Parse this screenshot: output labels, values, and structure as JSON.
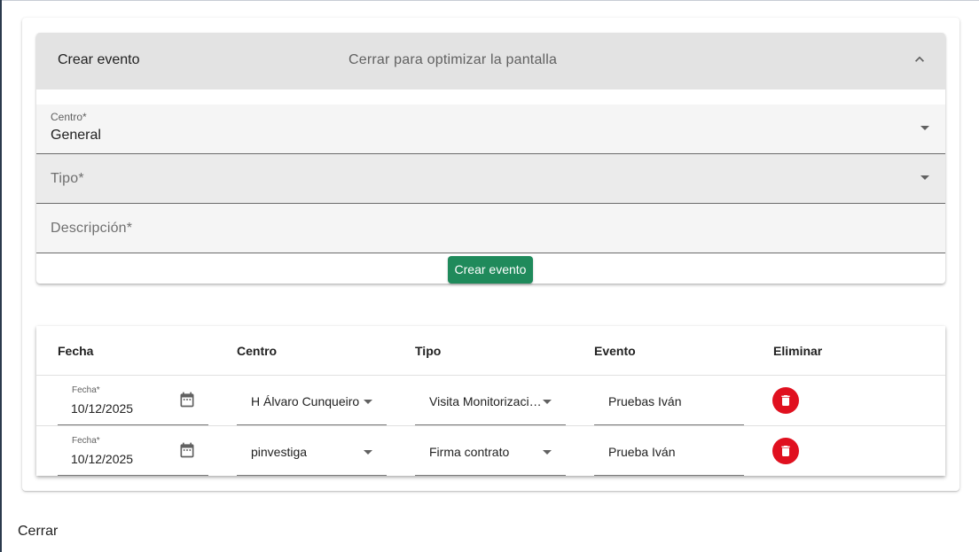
{
  "panel": {
    "title": "Crear evento",
    "description": "Cerrar para optimizar la pantalla",
    "expand_icon": "chevron-up-icon"
  },
  "form": {
    "centro": {
      "label": "Centro*",
      "value": "General"
    },
    "tipo": {
      "label": "Tipo*",
      "value": ""
    },
    "descripcion": {
      "label": "Descripción*",
      "value": ""
    },
    "submit_label": "Crear evento"
  },
  "table": {
    "headers": [
      "Fecha",
      "Centro",
      "Tipo",
      "Evento",
      "Eliminar"
    ],
    "rows": [
      {
        "fecha_label": "Fecha*",
        "fecha": "10/12/2025",
        "centro": "H Álvaro Cunqueiro",
        "tipo": "Visita Monitorización",
        "evento": "Pruebas Iván",
        "delete_icon": "trash-icon"
      },
      {
        "fecha_label": "Fecha*",
        "fecha": "10/12/2025",
        "centro": "pinvestiga",
        "tipo": "Firma contrato",
        "evento": "Prueba Iván",
        "delete_icon": "trash-icon"
      }
    ]
  },
  "footer": {
    "close_label": "Cerrar"
  },
  "colors": {
    "accent_green": "#1f8a5b",
    "delete_red": "#e0101f",
    "header_gray": "#e3e3e3"
  }
}
